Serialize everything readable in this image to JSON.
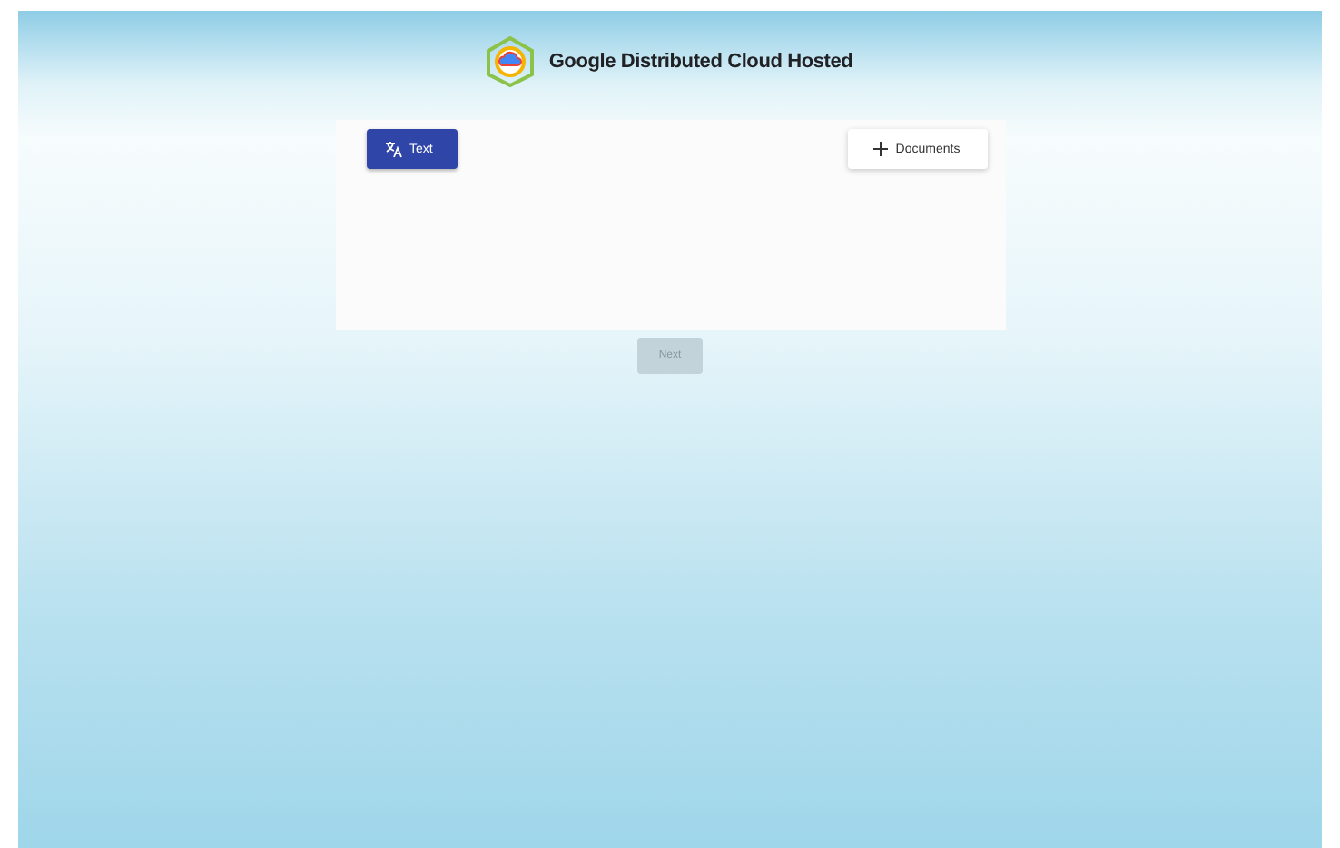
{
  "header": {
    "title": "Google Distributed Cloud Hosted"
  },
  "modes": [
    {
      "kind": "text",
      "label": "Text",
      "selected": true
    },
    {
      "kind": "documents",
      "label": "Documents",
      "selected": false
    }
  ],
  "next_button": {
    "label": "Next",
    "disabled": true
  }
}
